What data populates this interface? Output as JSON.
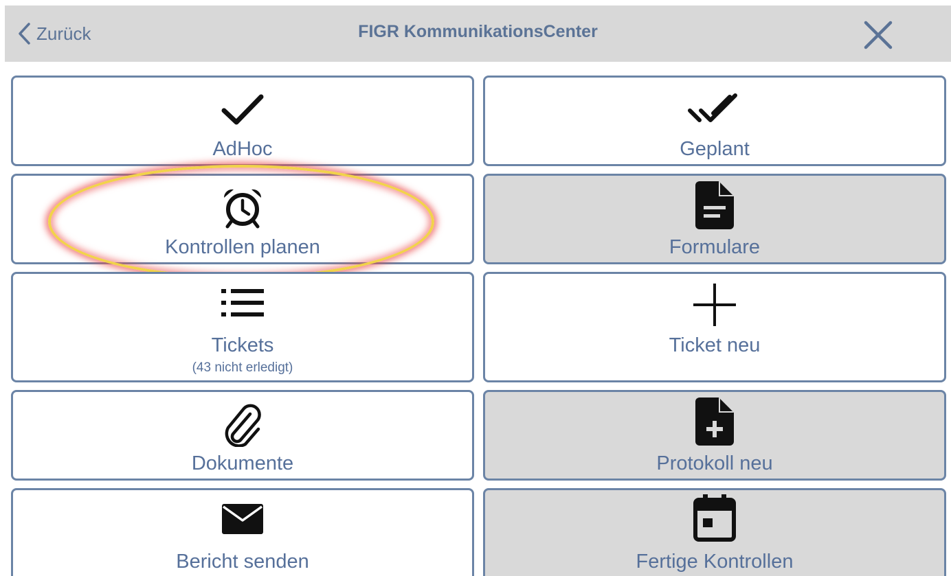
{
  "header": {
    "back_label": "Zurück",
    "title": "FIGR KommunikationsCenter",
    "close_icon": "close-icon",
    "back_icon": "chevron-left-icon"
  },
  "tiles": [
    {
      "label": "AdHoc",
      "icon": "checkmark-icon",
      "background": "#ffffff"
    },
    {
      "label": "Geplant",
      "icon": "double-checkmark-icon",
      "background": "#ffffff"
    },
    {
      "label": "Kontrollen planen",
      "icon": "alarm-clock-icon",
      "background": "#ffffff",
      "highlighted": true
    },
    {
      "label": "Formulare",
      "icon": "document-icon",
      "background": "#d9d9d9"
    },
    {
      "label": "Tickets",
      "sublabel": "(43 nicht erledigt)",
      "icon": "list-icon",
      "background": "#ffffff"
    },
    {
      "label": "Ticket neu",
      "icon": "plus-icon",
      "background": "#ffffff"
    },
    {
      "label": "Dokumente",
      "icon": "paperclip-icon",
      "background": "#ffffff"
    },
    {
      "label": "Protokoll neu",
      "icon": "document-plus-icon",
      "background": "#d9d9d9"
    },
    {
      "label": "Bericht senden",
      "icon": "envelope-icon",
      "background": "#ffffff"
    },
    {
      "label": "Fertige Kontrollen",
      "icon": "calendar-icon",
      "background": "#d9d9d9"
    }
  ],
  "colors": {
    "header_bg": "#d8d8d8",
    "label_text": "#56709a",
    "tile_border": "#6b84a6",
    "highlight_ring": "#f2d24a",
    "highlight_glow": "#eb5050"
  }
}
